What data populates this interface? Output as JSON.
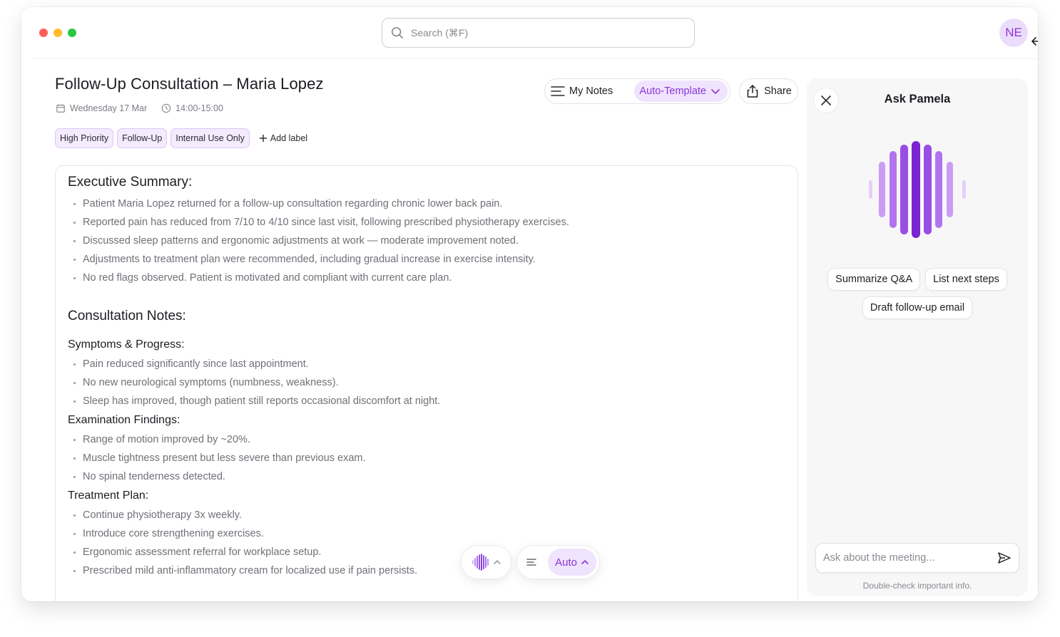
{
  "search": {
    "placeholder": "Search (⌘F)"
  },
  "user": {
    "initials": "NE"
  },
  "note": {
    "title": "Follow-Up Consultation – Maria Lopez",
    "date": "Wednesday 17 Mar",
    "time": "14:00-15:00",
    "labels": [
      "High Priority",
      "Follow-Up",
      "Internal Use Only"
    ],
    "add_label": "Add label"
  },
  "toolbar": {
    "my_notes": "My Notes",
    "template": "Auto-Template",
    "share": "Share"
  },
  "sections": {
    "executive_summary": {
      "heading": "Executive Summary:",
      "items": [
        "Patient Maria Lopez returned for a follow-up consultation regarding chronic lower back pain.",
        "Reported pain has reduced from 7/10 to 4/10 since last visit, following prescribed physiotherapy exercises.",
        "Discussed sleep patterns and ergonomic adjustments at work — moderate improvement noted.",
        "Adjustments to treatment plan were recommended, including gradual increase in exercise intensity.",
        "No red flags observed. Patient is motivated and compliant with current care plan."
      ]
    },
    "consultation_notes": {
      "heading": "Consultation Notes:"
    },
    "symptoms": {
      "heading": "Symptoms & Progress:",
      "items": [
        "Pain reduced significantly since last appointment.",
        "No new neurological symptoms (numbness, weakness).",
        "Sleep has improved, though patient still reports occasional discomfort at night."
      ]
    },
    "examination": {
      "heading": "Examination Findings:",
      "items": [
        "Range of motion improved by ~20%.",
        "Muscle tightness present but less severe than previous exam.",
        "No spinal tenderness detected."
      ]
    },
    "treatment": {
      "heading": "Treatment Plan:",
      "items": [
        "Continue physiotherapy 3x weekly.",
        "Introduce core strengthening exercises.",
        "Ergonomic assessment referral for workplace setup.",
        "Prescribed mild anti-inflammatory cream for localized use if pain persists."
      ]
    }
  },
  "bottom_bar": {
    "mode": "Auto"
  },
  "assistant": {
    "title": "Ask Pamela",
    "suggestions": [
      "Summarize Q&A",
      "List next steps",
      "Draft follow-up email"
    ],
    "input_placeholder": "Ask about the meeting...",
    "disclaimer": "Double-check important info."
  },
  "colors": {
    "accent": "#8a35d8",
    "accent_soft": "#f0e3fd",
    "chip_bg": "#f4ecfd"
  },
  "icons": [
    "search-icon",
    "calendar-icon",
    "clock-icon",
    "plus-icon",
    "menu-lines-icon",
    "chevron-down-icon",
    "share-icon",
    "close-icon",
    "voice-wave-icon",
    "chevron-up-icon",
    "send-icon",
    "arrow-left-icon"
  ]
}
